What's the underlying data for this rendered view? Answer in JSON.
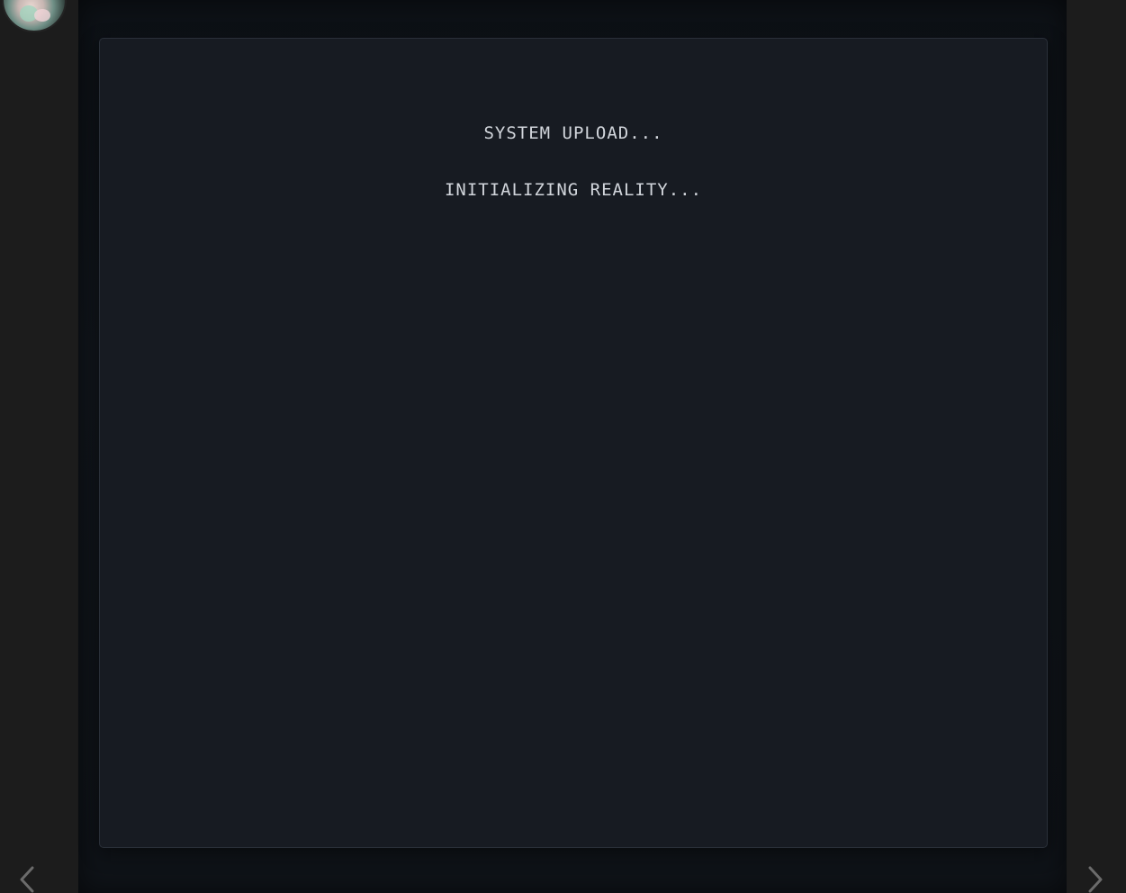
{
  "terminal": {
    "lines": [
      "SYSTEM UPLOAD...",
      "INITIALIZING REALITY..."
    ]
  },
  "navigation": {
    "prev_icon": "chevron-left-icon",
    "next_icon": "chevron-right-icon"
  },
  "colors": {
    "background": "#1b1b1b",
    "stage": "#11161c",
    "terminal_bg": "#171b22",
    "terminal_border": "#2a3039",
    "text": "#d2d6dc",
    "arrow": "#6b6b6b"
  }
}
